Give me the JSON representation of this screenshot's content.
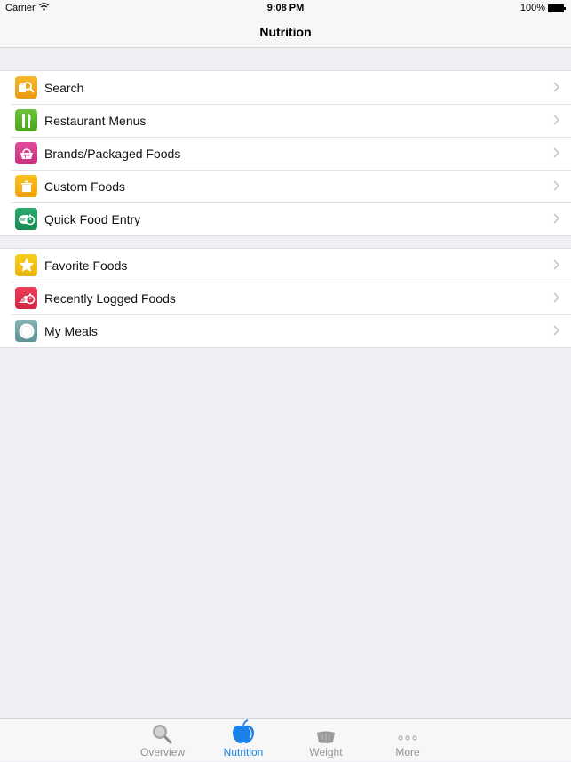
{
  "status_bar": {
    "carrier": "Carrier",
    "time": "9:08 PM",
    "battery": "100%",
    "wifi_icon": "wifi-icon",
    "battery_icon": "battery-full-icon"
  },
  "navbar": {
    "title": "Nutrition"
  },
  "groups": [
    {
      "items": [
        {
          "label": "Search",
          "icon": "search-food-icon",
          "color": "#f0a81c"
        },
        {
          "label": "Restaurant Menus",
          "icon": "fork-knife-icon",
          "color": "#5cb52c"
        },
        {
          "label": "Brands/Packaged Foods",
          "icon": "basket-icon",
          "color": "#d63a8c"
        },
        {
          "label": "Custom Foods",
          "icon": "pot-icon",
          "color": "#f5b412"
        },
        {
          "label": "Quick Food Entry",
          "icon": "quick-entry-icon",
          "color": "#1f9a62"
        }
      ]
    },
    {
      "items": [
        {
          "label": "Favorite Foods",
          "icon": "star-icon",
          "color": "#f2c10f"
        },
        {
          "label": "Recently Logged Foods",
          "icon": "recent-timer-icon",
          "color": "#e1324f"
        },
        {
          "label": "My Meals",
          "icon": "plate-icon",
          "color": "#6fa2a3"
        }
      ]
    }
  ],
  "tabbar": {
    "tabs": [
      {
        "label": "Overview",
        "icon": "magnifier-icon",
        "active": false
      },
      {
        "label": "Nutrition",
        "icon": "apple-icon",
        "active": true
      },
      {
        "label": "Weight",
        "icon": "scale-icon",
        "active": false
      },
      {
        "label": "More",
        "icon": "more-dots-icon",
        "active": false
      }
    ],
    "active_color": "#1a82e8",
    "inactive_color": "#929292"
  }
}
